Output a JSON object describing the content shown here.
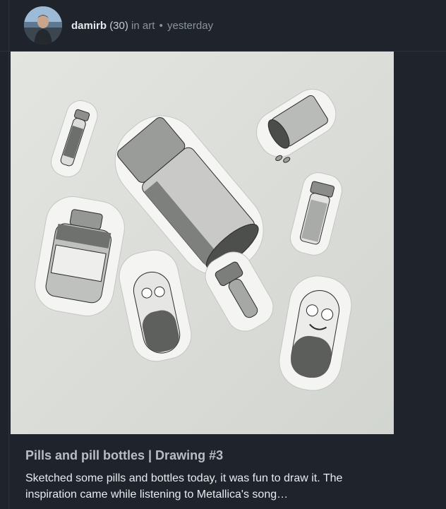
{
  "post": {
    "author": "damirb",
    "reputation": "(30)",
    "category_prefix": "in",
    "category": "art",
    "separator": "•",
    "time": "yesterday",
    "title": "Pills and pill bottles | Drawing #3",
    "excerpt_line1": "Sketched some pills and bottles today, it was fun to draw it. The",
    "excerpt_line2": "inspiration came while listening to Metallica's song…"
  },
  "icons": {
    "avatar": "user-avatar-icon"
  },
  "colors": {
    "background": "#1f232b",
    "author": "#e6e9ee",
    "meta": "#8a939e",
    "title": "#b7bec6",
    "excerpt": "#e8ebef"
  }
}
